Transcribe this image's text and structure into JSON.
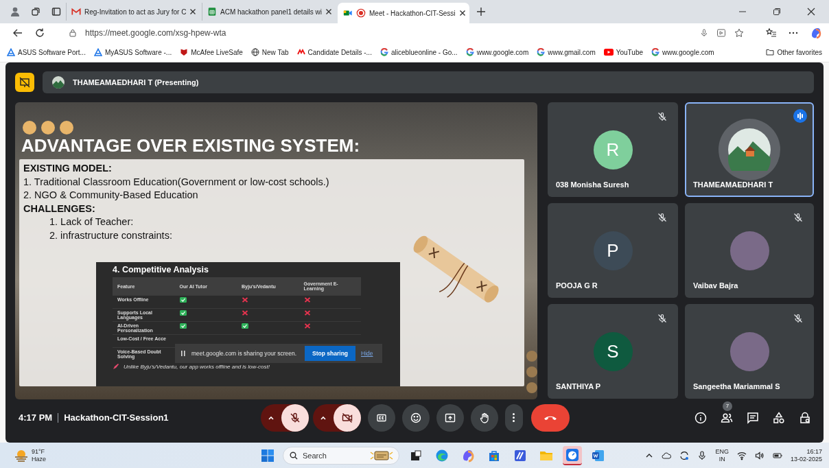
{
  "browser": {
    "tabs": [
      {
        "title": "Reg-Invitation to act as Jury for C",
        "kind": "mail",
        "selected": false
      },
      {
        "title": "ACM hackathon panel1 details wi",
        "kind": "sheet",
        "selected": false
      },
      {
        "title": "Meet - Hackathon-CIT-Sessi",
        "kind": "meet",
        "selected": true
      }
    ],
    "url": "https://meet.google.com/xsg-hpew-wta",
    "bookmarks": [
      {
        "label": "ASUS Software Port...",
        "kind": "triangle"
      },
      {
        "label": "MyASUS Software -...",
        "kind": "triangle"
      },
      {
        "label": "McAfee LiveSafe",
        "kind": "shield"
      },
      {
        "label": "New Tab",
        "kind": "globe"
      },
      {
        "label": "Candidate Details -...",
        "kind": "mark"
      },
      {
        "label": "aliceblueonline - Go...",
        "kind": "g"
      },
      {
        "label": "www.google.com",
        "kind": "g"
      },
      {
        "label": "www.gmail.com",
        "kind": "g"
      },
      {
        "label": "YouTube",
        "kind": "play"
      },
      {
        "label": "www.google.com",
        "kind": "g"
      }
    ],
    "other_favorites": "Other favorites"
  },
  "meet": {
    "presenter": "THAMEAMAEDHARI T (Presenting)",
    "slide": {
      "title": "ADVANTAGE OVER EXISTING SYSTEM:",
      "lines": [
        {
          "text": "EXISTING MODEL:",
          "kind": "heading"
        },
        {
          "text": "1. Traditional Classroom Education(Government or low-cost schools.)",
          "kind": "item"
        },
        {
          "text": "2. NGO & Community-Based Education",
          "kind": "item"
        },
        {
          "text": "CHALLENGES:",
          "kind": "heading"
        },
        {
          "text": "1. Lack of Teacher:",
          "kind": "subitem"
        },
        {
          "text": "2. infrastructure constraints:",
          "kind": "subitem"
        }
      ],
      "table_image": {
        "heading": "4. Competitive Analysis",
        "columns": [
          "Feature",
          "Our AI Tutor",
          "Byju's/Vedantu",
          "Government E-Learning"
        ],
        "rows": [
          {
            "feature": "Works Offline",
            "marks": [
              true,
              false,
              false
            ]
          },
          {
            "feature": "Supports Local Languages",
            "marks": [
              true,
              false,
              false
            ]
          },
          {
            "feature": "AI-Driven Personalization",
            "marks": [
              true,
              true,
              false
            ]
          },
          {
            "feature": "Low-Cost / Free Acce",
            "marks": []
          },
          {
            "feature": "Voice-Based Doubt Solving",
            "marks": []
          }
        ],
        "footnote": "Unlike Byju's/Vedantu, our app works offline and is low-cost!"
      }
    },
    "share_notice": {
      "message": "meet.google.com is sharing your screen.",
      "stop": "Stop sharing",
      "hide": "Hide"
    },
    "participants": [
      {
        "name": "038 Monisha Suresh",
        "kind": "letter",
        "initial": "R",
        "color": "#7fcf9c",
        "muted": true,
        "speaking": false
      },
      {
        "name": "THAMEAMAEDHARI T",
        "kind": "picture",
        "muted": false,
        "speaking": true
      },
      {
        "name": "POOJA G R",
        "kind": "letter",
        "initial": "P",
        "color": "#3d4b57",
        "muted": true,
        "speaking": false
      },
      {
        "name": "Vaibav Bajra",
        "kind": "photo",
        "muted": true,
        "speaking": false
      },
      {
        "name": "SANTHIYA P",
        "kind": "letter",
        "initial": "S",
        "color": "#0f5a3f",
        "muted": true,
        "speaking": false
      },
      {
        "name": "Sangeetha Mariammal S",
        "kind": "photo",
        "muted": true,
        "speaking": false
      }
    ],
    "time": "4:17 PM",
    "meeting": "Hackathon-CIT-Session1",
    "mic_on": false,
    "camera_on": false,
    "people_count": "7"
  },
  "taskbar": {
    "temperature": "91°F",
    "condition": "Haze",
    "search_placeholder": "Search",
    "apps": [
      {
        "kind": "widget",
        "selected": false
      },
      {
        "kind": "edge",
        "selected": false
      },
      {
        "kind": "copilot",
        "selected": false
      },
      {
        "kind": "store",
        "selected": false
      },
      {
        "kind": "editor",
        "selected": false
      },
      {
        "kind": "folder",
        "selected": false
      },
      {
        "kind": "clock",
        "selected": true
      },
      {
        "kind": "word",
        "selected": false
      }
    ],
    "language": "ENG",
    "region": "IN",
    "clock": "16:17",
    "date": "13-02-2025"
  }
}
